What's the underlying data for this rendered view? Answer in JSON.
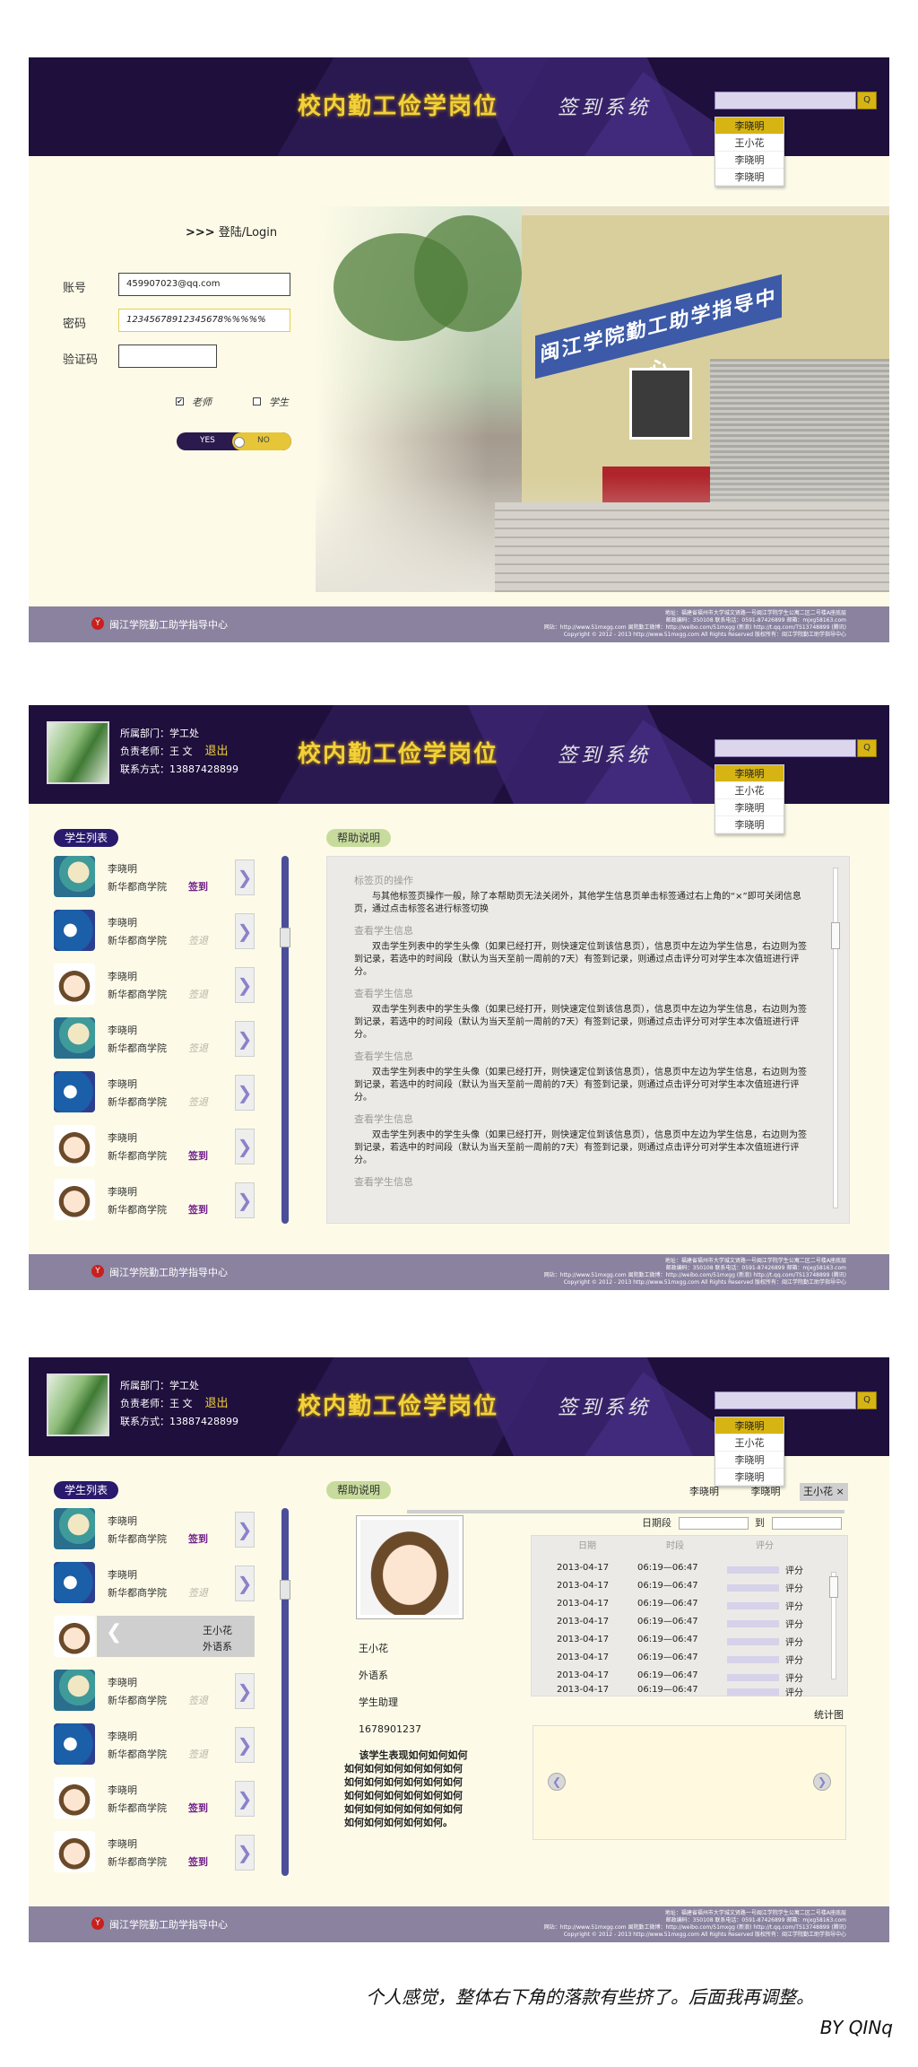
{
  "header": {
    "brand": "校内勤工俭学岗位",
    "subtitle": "签到系统",
    "search_button": "Q",
    "dropdown": [
      "李晓明",
      "王小花",
      "李晓明",
      "李晓明"
    ]
  },
  "footer": {
    "logo": "Y",
    "org": "闽江学院勤工助学指导中心",
    "lines": [
      "地址：福建省福州市大学城文贤路一号闽江学院学生公寓二区二号楼A座底层",
      "邮政编码：350108 联系电话：0591-87426899 邮箱：mjxg58163.com",
      "网站：http://www.51mxgg.com 闽院勤工微博：http://weibo.com/51mxgg (新浪) http://t.qq.com/TS13748899 (腾讯)",
      "Copyright © 2012 - 2013 http://www.51mxgg.com All Rights Reserved 版权所有：闽江学院勤工助学指导中心"
    ]
  },
  "login": {
    "title_arrows": ">>>",
    "title": "登陆/Login",
    "account_label": "账号",
    "account_value": "459907023@qq.com",
    "password_label": "密码",
    "password_value": "12345678912345678%%%%%",
    "captcha_label": "验证码",
    "role_teacher": "老师",
    "role_student": "学生",
    "teacher_checked": "✔",
    "toggle_yes": "YES",
    "toggle_no": "NO",
    "photo_banner": "闽江学院勤工助学指导中心"
  },
  "user": {
    "dept": "所属部门：学工处",
    "teacher": "负责老师：王 文",
    "phone": "联系方式：13887428899",
    "logout": "退出"
  },
  "list": {
    "title": "学生列表",
    "arrow": "❯",
    "students": [
      {
        "name": "李晓明",
        "dept": "新华都商学院",
        "status": "签到"
      },
      {
        "name": "李晓明",
        "dept": "新华都商学院",
        "status": "签退"
      },
      {
        "name": "李晓明",
        "dept": "新华都商学院",
        "status": "签退"
      },
      {
        "name": "李晓明",
        "dept": "新华都商学院",
        "status": "签退"
      },
      {
        "name": "李晓明",
        "dept": "新华都商学院",
        "status": "签退"
      },
      {
        "name": "李晓明",
        "dept": "新华都商学院",
        "status": "签到"
      },
      {
        "name": "李晓明",
        "dept": "新华都商学院",
        "status": "签到"
      }
    ],
    "open_name": "王小花",
    "open_dept": "外语系",
    "open_back": "❮"
  },
  "help": {
    "title": "帮助说明",
    "sections": [
      {
        "h": "标签页的操作",
        "p": "与其他标签页操作一般，除了本帮助页无法关闭外，其他学生信息页单击标签通过右上角的“×”即可关闭信息页，通过点击标签名进行标签切换"
      },
      {
        "h": "查看学生信息",
        "p": "双击学生列表中的学生头像（如果已经打开，则快速定位到该信息页），信息页中左边为学生信息，右边则为签到记录，若选中的时间段（默认为当天至前一周前的7天）有签到记录，则通过点击评分可对学生本次值班进行评分。"
      },
      {
        "h": "查看学生信息",
        "p": "双击学生列表中的学生头像（如果已经打开，则快速定位到该信息页），信息页中左边为学生信息，右边则为签到记录，若选中的时间段（默认为当天至前一周前的7天）有签到记录，则通过点击评分可对学生本次值班进行评分。"
      },
      {
        "h": "查看学生信息",
        "p": "双击学生列表中的学生头像（如果已经打开，则快速定位到该信息页），信息页中左边为学生信息，右边则为签到记录，若选中的时间段（默认为当天至前一周前的7天）有签到记录，则通过点击评分可对学生本次值班进行评分。"
      },
      {
        "h": "查看学生信息",
        "p": "双击学生列表中的学生头像（如果已经打开，则快速定位到该信息页），信息页中左边为学生信息，右边则为签到记录，若选中的时间段（默认为当天至前一周前的7天）有签到记录，则通过点击评分可对学生本次值班进行评分。"
      },
      {
        "h": "查看学生信息",
        "p": ""
      }
    ]
  },
  "detail": {
    "tab_a": "李晓明",
    "tab_b": "李晓明",
    "tab_active": "王小花 ×",
    "date_label": "日期段",
    "date_to": "到",
    "name": "王小花",
    "dept": "外语系",
    "role": "学生助理",
    "phone": "1678901237",
    "note": "该学生表现如何如何如何如何如何如何如何如何如何如何如何如何如何如何如何如何如何如何如何如何如何如何如何如何如何如何如何如何如何如何如何如何。",
    "record_head": {
      "date": "日期",
      "time": "时段",
      "score": "评分"
    },
    "records": [
      {
        "date": "2013-04-17",
        "time": "06:19—06:47",
        "score": "评分"
      },
      {
        "date": "2013-04-17",
        "time": "06:19—06:47",
        "score": "评分"
      },
      {
        "date": "2013-04-17",
        "time": "06:19—06:47",
        "score": "评分"
      },
      {
        "date": "2013-04-17",
        "time": "06:19—06:47",
        "score": "评分"
      },
      {
        "date": "2013-04-17",
        "time": "06:19—06:47",
        "score": "评分"
      },
      {
        "date": "2013-04-17",
        "time": "06:19—06:47",
        "score": "评分"
      },
      {
        "date": "2013-04-17",
        "time": "06:19—06:47",
        "score": "评分"
      },
      {
        "date": "2013-04-17",
        "time": "06:19—06:47",
        "score": "评分"
      }
    ],
    "stat_label": "统计图",
    "prev": "❮",
    "next": "❯"
  },
  "caption": {
    "note": "个人感觉，整体右下角的落款有些挤了。后面我再调整。",
    "by": "BY QINq"
  }
}
